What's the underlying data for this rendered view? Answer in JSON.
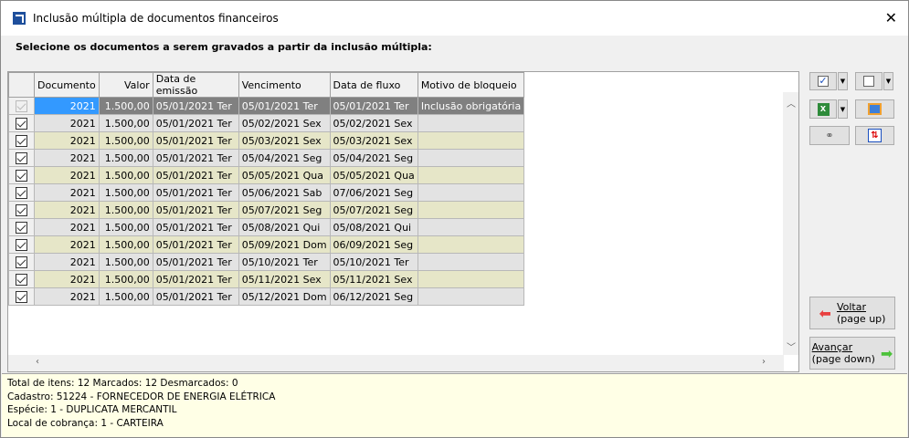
{
  "window": {
    "title": "Inclusão múltipla de documentos financeiros",
    "close_icon": "close-icon"
  },
  "subtitle": "Selecione os documentos a serem gravados a partir da inclusão múltipla:",
  "grid": {
    "columns": [
      "",
      "Documento",
      "Valor",
      "Data de emissão",
      "Vencimento",
      "Data de fluxo",
      "Motivo de bloqueio"
    ],
    "rows": [
      {
        "checked": true,
        "disabled": true,
        "doc": "2021",
        "valor": "1.500,00",
        "emissao": "05/01/2021 Ter",
        "venc": "05/01/2021 Ter",
        "fluxo": "05/01/2021 Ter",
        "motivo": "Inclusão obrigatória"
      },
      {
        "checked": true,
        "doc": "2021",
        "valor": "1.500,00",
        "emissao": "05/01/2021 Ter",
        "venc": "05/02/2021 Sex",
        "fluxo": "05/02/2021 Sex",
        "motivo": ""
      },
      {
        "checked": true,
        "doc": "2021",
        "valor": "1.500,00",
        "emissao": "05/01/2021 Ter",
        "venc": "05/03/2021 Sex",
        "fluxo": "05/03/2021 Sex",
        "motivo": ""
      },
      {
        "checked": true,
        "doc": "2021",
        "valor": "1.500,00",
        "emissao": "05/01/2021 Ter",
        "venc": "05/04/2021 Seg",
        "fluxo": "05/04/2021 Seg",
        "motivo": ""
      },
      {
        "checked": true,
        "doc": "2021",
        "valor": "1.500,00",
        "emissao": "05/01/2021 Ter",
        "venc": "05/05/2021 Qua",
        "fluxo": "05/05/2021 Qua",
        "motivo": ""
      },
      {
        "checked": true,
        "doc": "2021",
        "valor": "1.500,00",
        "emissao": "05/01/2021 Ter",
        "venc": "05/06/2021 Sab",
        "fluxo": "07/06/2021 Seg",
        "motivo": ""
      },
      {
        "checked": true,
        "doc": "2021",
        "valor": "1.500,00",
        "emissao": "05/01/2021 Ter",
        "venc": "05/07/2021 Seg",
        "fluxo": "05/07/2021 Seg",
        "motivo": ""
      },
      {
        "checked": true,
        "doc": "2021",
        "valor": "1.500,00",
        "emissao": "05/01/2021 Ter",
        "venc": "05/08/2021 Qui",
        "fluxo": "05/08/2021 Qui",
        "motivo": ""
      },
      {
        "checked": true,
        "doc": "2021",
        "valor": "1.500,00",
        "emissao": "05/01/2021 Ter",
        "venc": "05/09/2021 Dom",
        "fluxo": "06/09/2021 Seg",
        "motivo": ""
      },
      {
        "checked": true,
        "doc": "2021",
        "valor": "1.500,00",
        "emissao": "05/01/2021 Ter",
        "venc": "05/10/2021 Ter",
        "fluxo": "05/10/2021 Ter",
        "motivo": ""
      },
      {
        "checked": true,
        "doc": "2021",
        "valor": "1.500,00",
        "emissao": "05/01/2021 Ter",
        "venc": "05/11/2021 Sex",
        "fluxo": "05/11/2021 Sex",
        "motivo": ""
      },
      {
        "checked": true,
        "doc": "2021",
        "valor": "1.500,00",
        "emissao": "05/01/2021 Ter",
        "venc": "05/12/2021 Dom",
        "fluxo": "06/12/2021 Seg",
        "motivo": ""
      }
    ]
  },
  "buttons": {
    "voltar_label": "Voltar",
    "voltar_sub": "(page up)",
    "avancar_label": "Avançar",
    "avancar_sub": "(page down)"
  },
  "info": {
    "line1": "Total de itens: 12 Marcados: 12 Desmarcados: 0",
    "line2": "Cadastro: 51224 - FORNECEDOR DE ENERGIA ELÉTRICA",
    "line3": "Espécie: 1 - DUPLICATA MERCANTIL",
    "line4": "Local de cobrança: 1 - CARTEIRA"
  },
  "colors": {
    "selected_row": "#808080",
    "selected_cell": "#3399ff",
    "row_gray": "#e3e3e3",
    "row_olive": "#e6e6c8",
    "info_bg": "#ffffe6"
  }
}
